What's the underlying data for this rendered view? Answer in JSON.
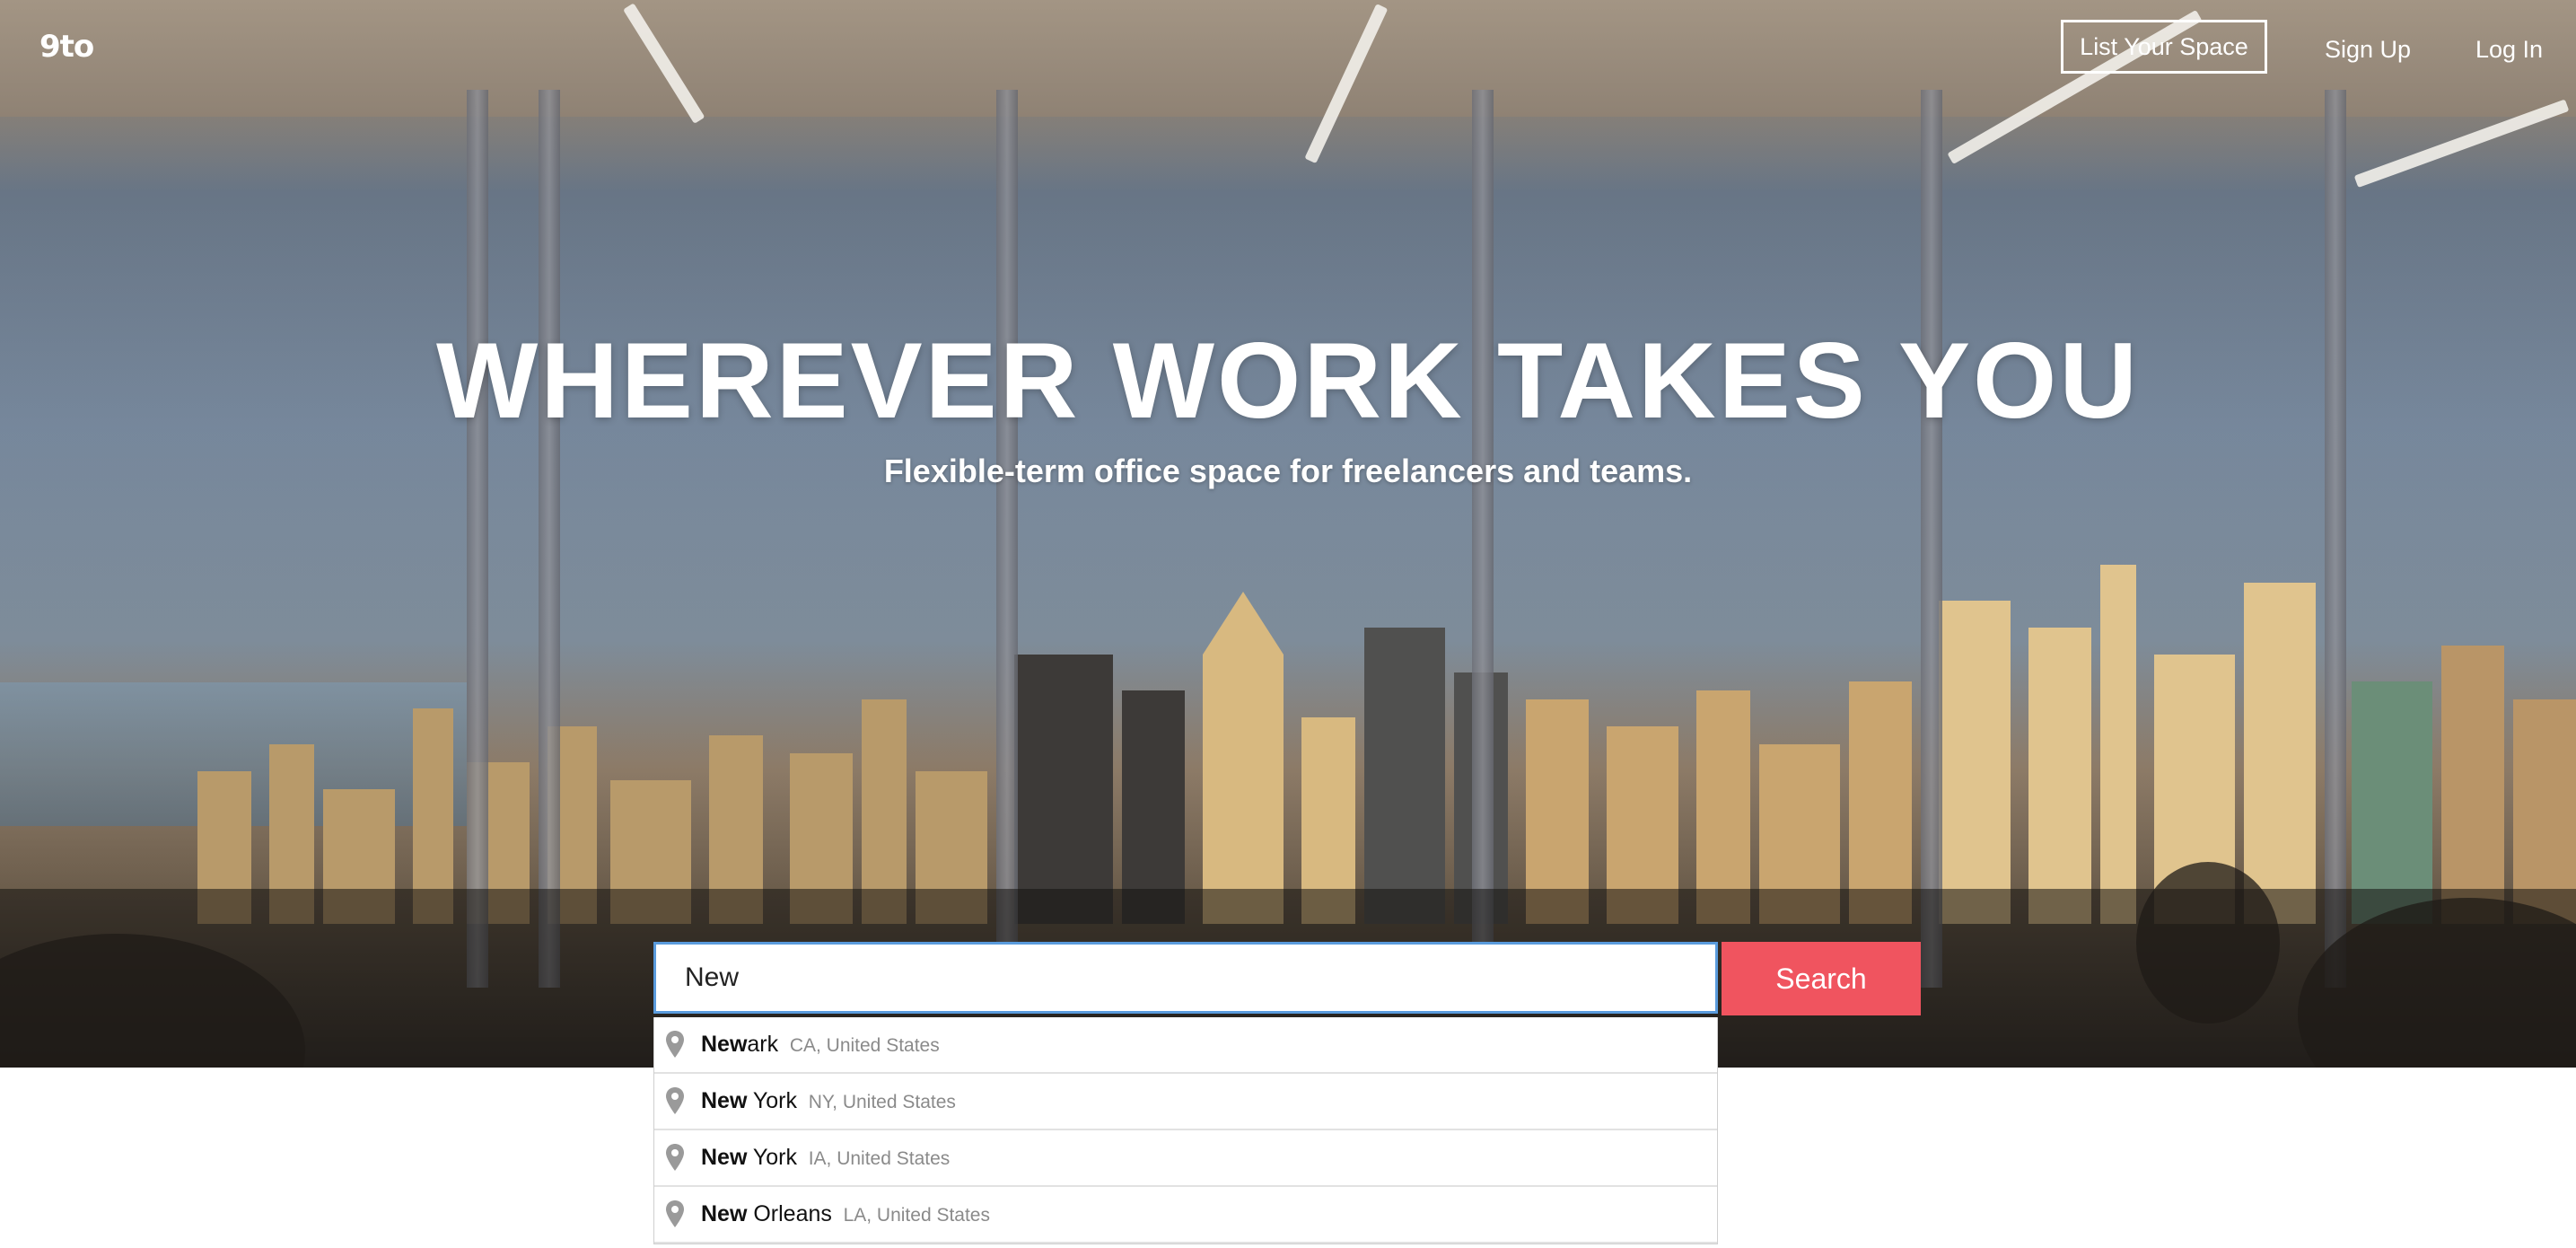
{
  "brand": {
    "logo": "9to"
  },
  "nav": {
    "list_space": "List Your Space",
    "sign_up": "Sign Up",
    "log_in": "Log In"
  },
  "hero": {
    "headline": "WHEREVER WORK TAKES YOU",
    "subheadline": "Flexible-term office space for freelancers and teams."
  },
  "search": {
    "value": "New",
    "button_label": "Search"
  },
  "suggestions": [
    {
      "match": "New",
      "rest": "ark",
      "secondary": "CA, United States"
    },
    {
      "match": "New",
      "rest": " York",
      "secondary": "NY, United States"
    },
    {
      "match": "New",
      "rest": " York",
      "secondary": "IA, United States"
    },
    {
      "match": "New",
      "rest": " Orleans",
      "secondary": "LA, United States"
    }
  ],
  "colors": {
    "search_button": "#f0545f",
    "input_focus_border": "#5a9bdc"
  },
  "icons": {
    "suggestion": "map-pin-icon"
  }
}
